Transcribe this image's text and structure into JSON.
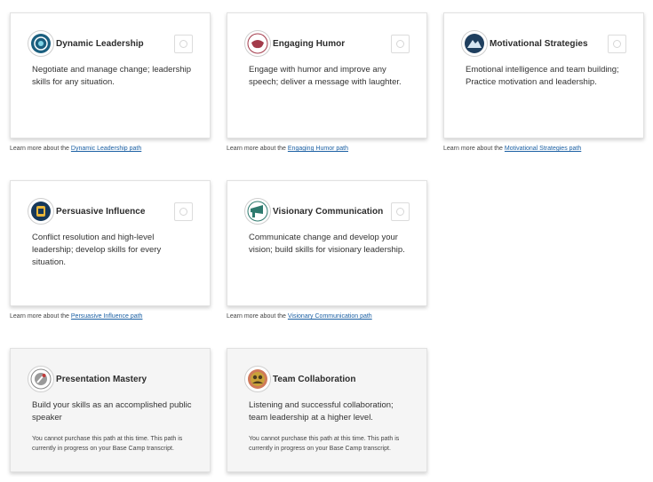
{
  "paths": [
    {
      "key": "dynamic-leadership",
      "title": "Dynamic Leadership",
      "description": "Negotiate and manage change; leadership skills for any situation.",
      "learn_prefix": "Learn more about the ",
      "link": "Dynamic Leadership path",
      "badge_icon": "dynamic-leadership-badge-icon",
      "badge_color": "#1b5f7f"
    },
    {
      "key": "engaging-humor",
      "title": "Engaging Humor",
      "description": "Engage with humor and improve any speech; deliver a message with laughter.",
      "learn_prefix": "Learn more about the ",
      "link": "Engaging Humor path",
      "badge_icon": "engaging-humor-badge-icon",
      "badge_color": "#a33a4a"
    },
    {
      "key": "motivational-strategies",
      "title": "Motivational Strategies",
      "description": "Emotional intelligence and team building; Practice motivation and leadership.",
      "learn_prefix": "Learn more about the ",
      "link": "Motivational Strategies path",
      "badge_icon": "motivational-strategies-badge-icon",
      "badge_color": "#1f3f5f"
    },
    {
      "key": "persuasive-influence",
      "title": "Persuasive Influence",
      "description": "Conflict resolution and high-level leadership; develop skills for every situation.",
      "learn_prefix": "Learn more about the ",
      "link": "Persuasive Influence path",
      "badge_icon": "persuasive-influence-badge-icon",
      "badge_color": "#16385a"
    },
    {
      "key": "visionary-communication",
      "title": "Visionary Communication",
      "description": "Communicate change and develop your vision; build skills for visionary leadership.",
      "learn_prefix": "Learn more about the ",
      "link": "Visionary Communication path",
      "badge_icon": "visionary-communication-badge-icon",
      "badge_color": "#2e7a6e"
    },
    {
      "key": "presentation-mastery",
      "title": "Presentation Mastery",
      "description": "Build your skills as an accomplished public speaker",
      "notice": "You cannot purchase this path at this time. This path is currently in progress on your Base Camp transcript.",
      "badge_icon": "presentation-mastery-badge-icon",
      "badge_color": "#8a8a8a"
    },
    {
      "key": "team-collaboration",
      "title": "Team Collaboration",
      "description": "Listening and successful collaboration; team leadership at a higher level.",
      "notice": "You cannot purchase this path at this time. This path is currently in progress on your Base Camp transcript.",
      "badge_icon": "team-collaboration-badge-icon",
      "badge_color": "#c9a23a"
    }
  ]
}
